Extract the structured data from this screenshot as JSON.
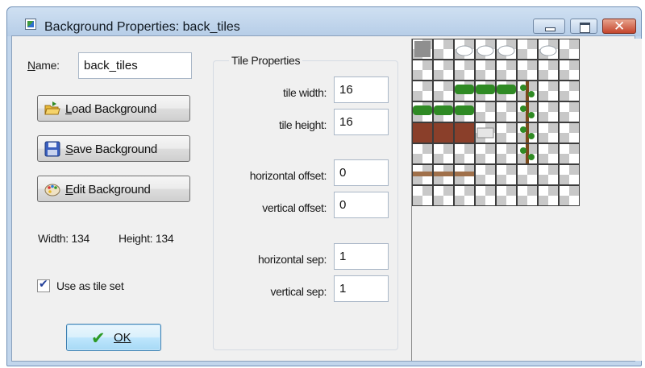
{
  "window": {
    "title": "Background Properties: back_tiles",
    "icon": "background-resource-icon",
    "controls": [
      "minimize-icon",
      "maximize-icon",
      "close-icon"
    ]
  },
  "name_field": {
    "label": "Name:",
    "value": "back_tiles"
  },
  "buttons": {
    "load": {
      "label": "Load Background",
      "icon": "folder-open-icon"
    },
    "save": {
      "label": "Save Background",
      "icon": "floppy-disk-icon"
    },
    "edit": {
      "label": "Edit Background",
      "icon": "paint-palette-icon"
    }
  },
  "dimensions": {
    "width_text": "Width: 134",
    "height_text": "Height: 134"
  },
  "tileset_checkbox": {
    "label": "Use as tile set",
    "checked": true
  },
  "ok_button": {
    "label": "OK",
    "icon": "checkmark-icon"
  },
  "tile_properties": {
    "title": "Tile Properties",
    "tile_width": {
      "label": "tile width:",
      "value": "16"
    },
    "tile_height": {
      "label": "tile height:",
      "value": "16"
    },
    "horizontal_offset": {
      "label": "horizontal offset:",
      "value": "0"
    },
    "vertical_offset": {
      "label": "vertical offset:",
      "value": "0"
    },
    "horizontal_sep": {
      "label": "horizontal sep:",
      "value": "1"
    },
    "vertical_sep": {
      "label": "vertical sep:",
      "value": "1"
    }
  },
  "colors": {
    "grid_line": "#3c3c3c",
    "checker_light": "#ffffff",
    "checker_dark": "#c8c8c8",
    "grass": "#2f8a24",
    "dirt": "#8a3f2a",
    "ok_accent": "#2c9a25"
  }
}
